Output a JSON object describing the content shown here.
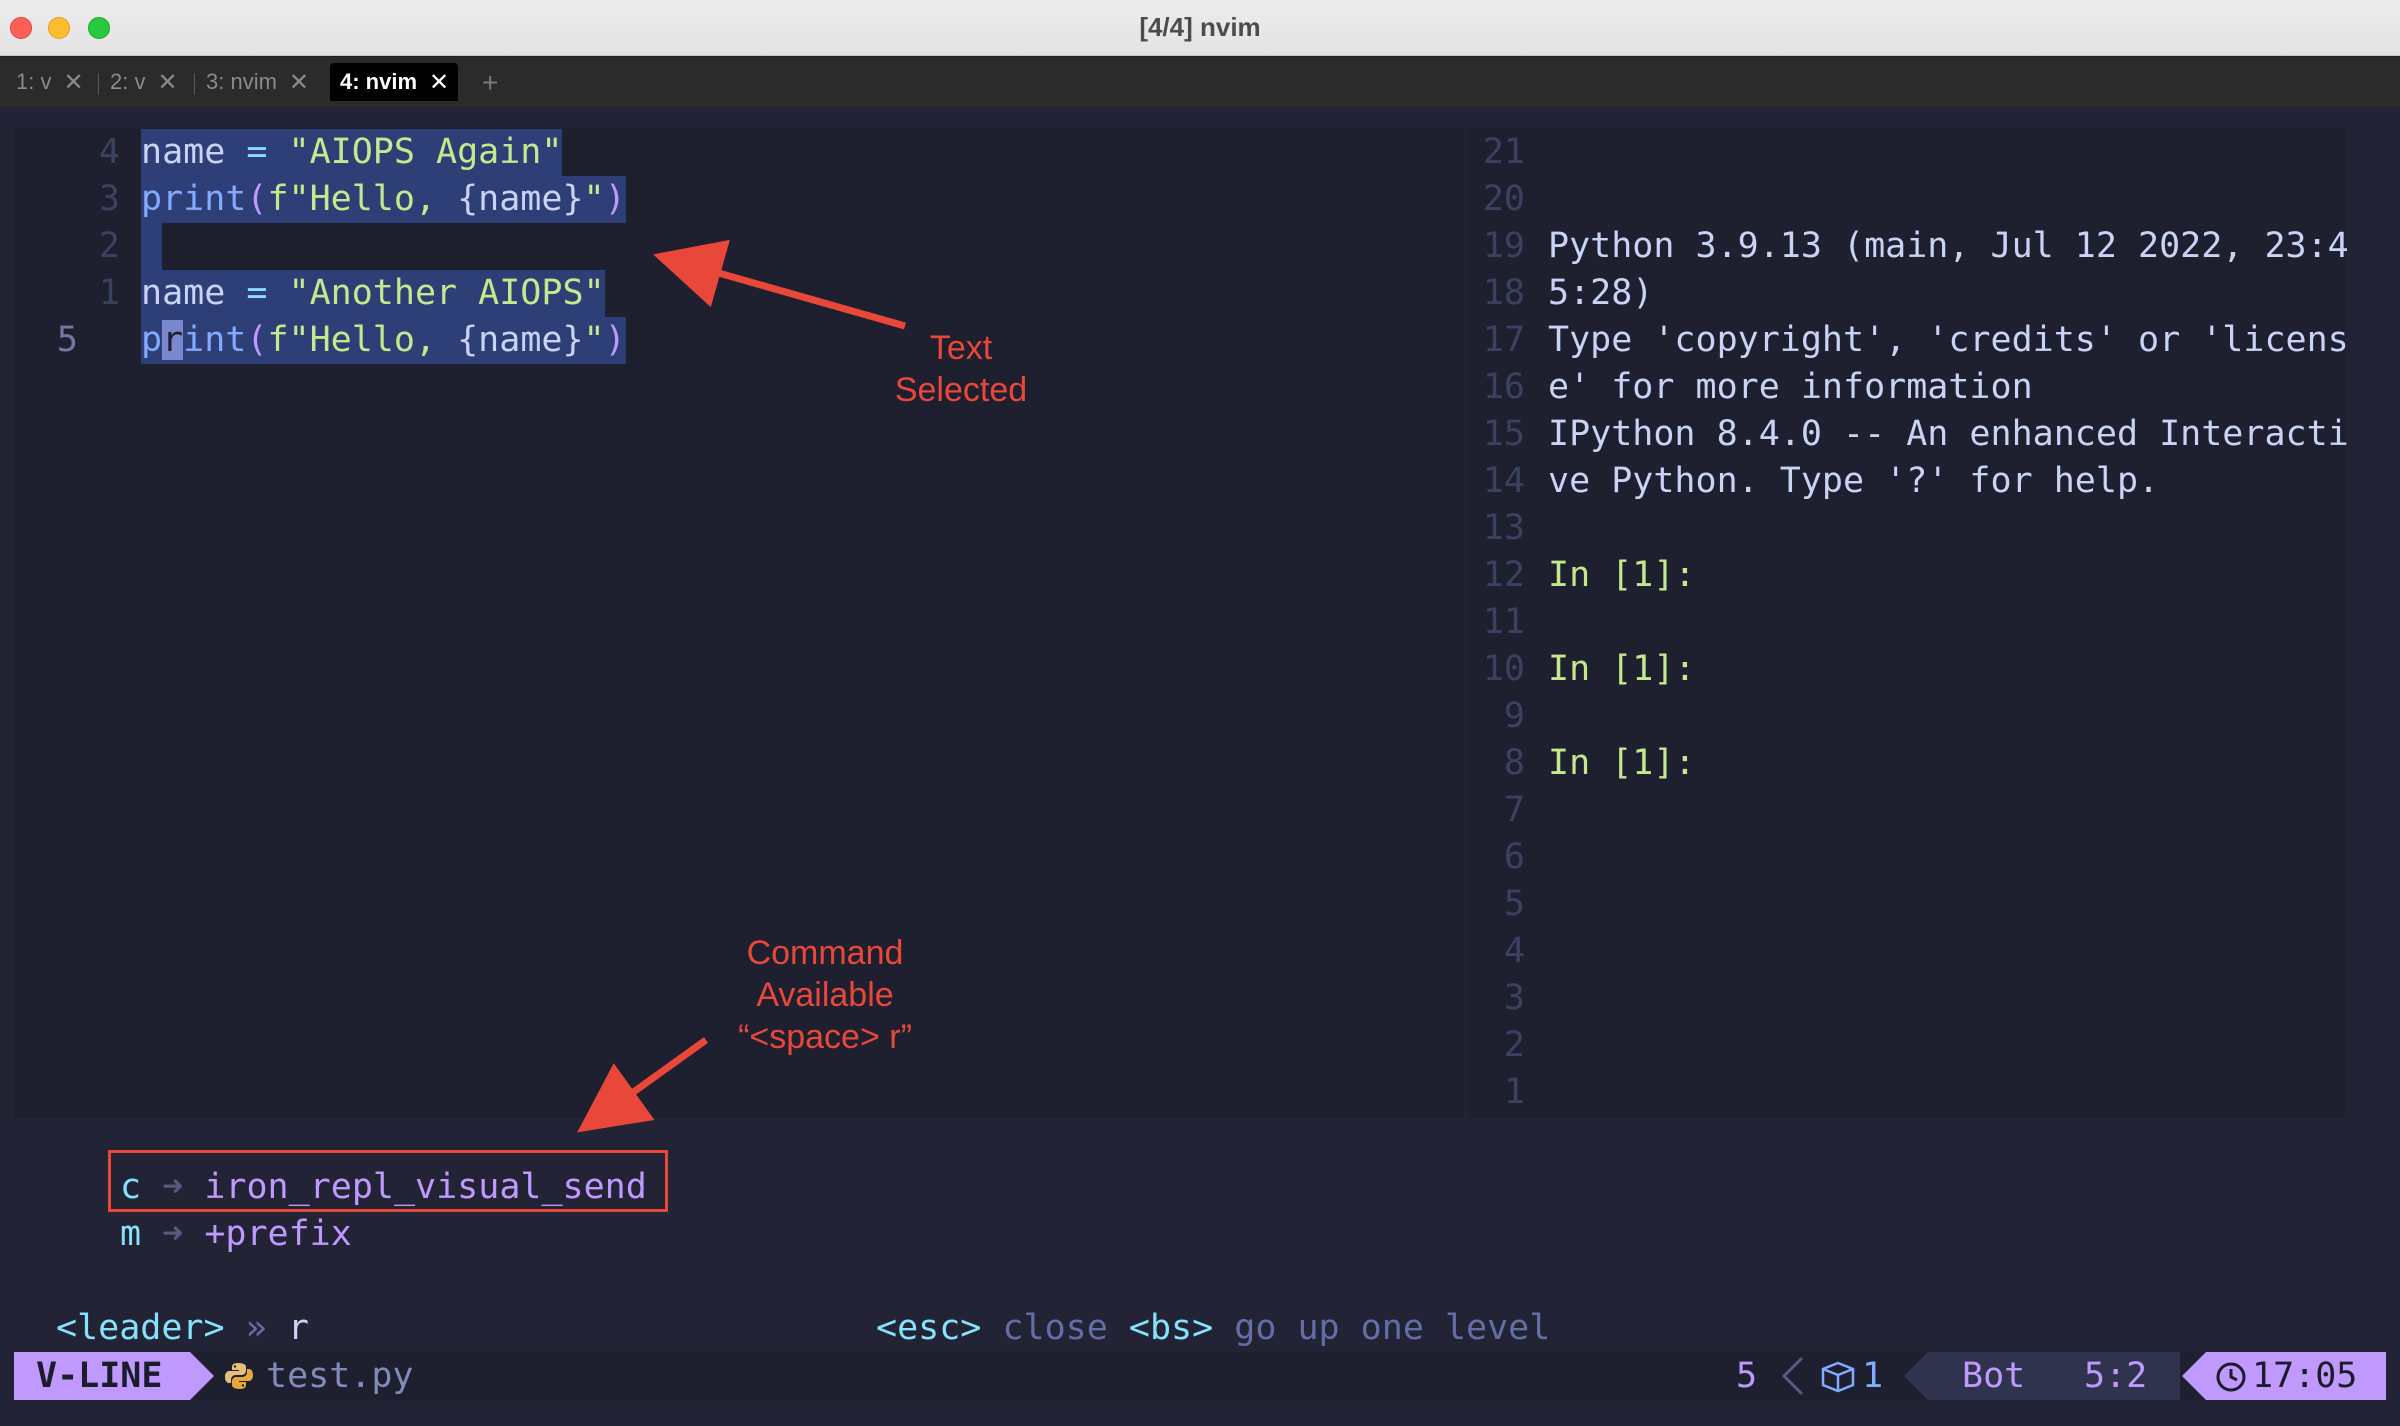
{
  "window": {
    "title": "[4/4] nvim"
  },
  "tabs": [
    {
      "label": "1: v",
      "close": "✕"
    },
    {
      "label": "2: v",
      "close": "✕"
    },
    {
      "label": "3: nvim",
      "close": "✕"
    },
    {
      "label": "4: nvim",
      "close": "✕"
    }
  ],
  "tab_add": "+",
  "editor": {
    "line_numbers": [
      "4",
      "3",
      "2",
      "1",
      "5"
    ],
    "lines": [
      {
        "a": "name",
        "b": " = ",
        "c": "\"AIOPS Again\""
      },
      {
        "fn": "print",
        "p1": "(",
        "s1": "f\"Hello, ",
        "br": "{name}",
        "s2": "\"",
        "p2": ")"
      },
      {
        "blank": " "
      },
      {
        "a": "name",
        "b": " = ",
        "c": "\"Another AIOPS\""
      },
      {
        "pre": "p",
        "cur": "r",
        "fn": "int",
        "p1": "(",
        "s1": "f\"Hello, ",
        "br": "{name}",
        "s2": "\"",
        "p2": ")"
      }
    ]
  },
  "repl": {
    "line_numbers": [
      "21",
      "20",
      "19",
      "18",
      "17",
      "16",
      "15",
      "14",
      "13",
      "12",
      "11",
      "10",
      "9",
      "8",
      "7",
      "6",
      "5",
      "4",
      "3",
      "2",
      "1"
    ],
    "lines": [
      "Python 3.9.13 (main, Jul 12 2022, 23:4",
      "5:28)",
      "Type 'copyright', 'credits' or 'licens",
      "e' for more information",
      "IPython 8.4.0 -- An enhanced Interacti",
      "ve Python. Type '?' for help."
    ],
    "prompts": [
      "In [1]:",
      "In [1]:",
      "In [1]:"
    ]
  },
  "which_key": {
    "items": [
      {
        "key": "c",
        "arrow": "➜",
        "desc": "iron_repl_visual_send"
      },
      {
        "key": "m",
        "arrow": "➜",
        "desc": "+prefix"
      }
    ],
    "breadcrumb_leader": "<leader>",
    "breadcrumb_sep": "»",
    "breadcrumb_key": "r",
    "hint_esc_key": "<esc>",
    "hint_esc_txt": "close",
    "hint_bs_key": "<bs>",
    "hint_bs_txt": "go up one level"
  },
  "statusline": {
    "mode": "V-LINE",
    "file": "test.py",
    "selected_lines": "5",
    "buffer_count": "1",
    "position_label": "Bot",
    "cursor_pos": "5:2",
    "time": "17:05"
  },
  "annotations": {
    "text_selected": [
      "Text",
      "Selected"
    ],
    "command_available": [
      "Command",
      "Available",
      "“<space> r”"
    ]
  },
  "colors": {
    "accent": "#c099ff",
    "annotation": "#e8473a",
    "selection": "#2d3f76",
    "background": "#222436"
  }
}
